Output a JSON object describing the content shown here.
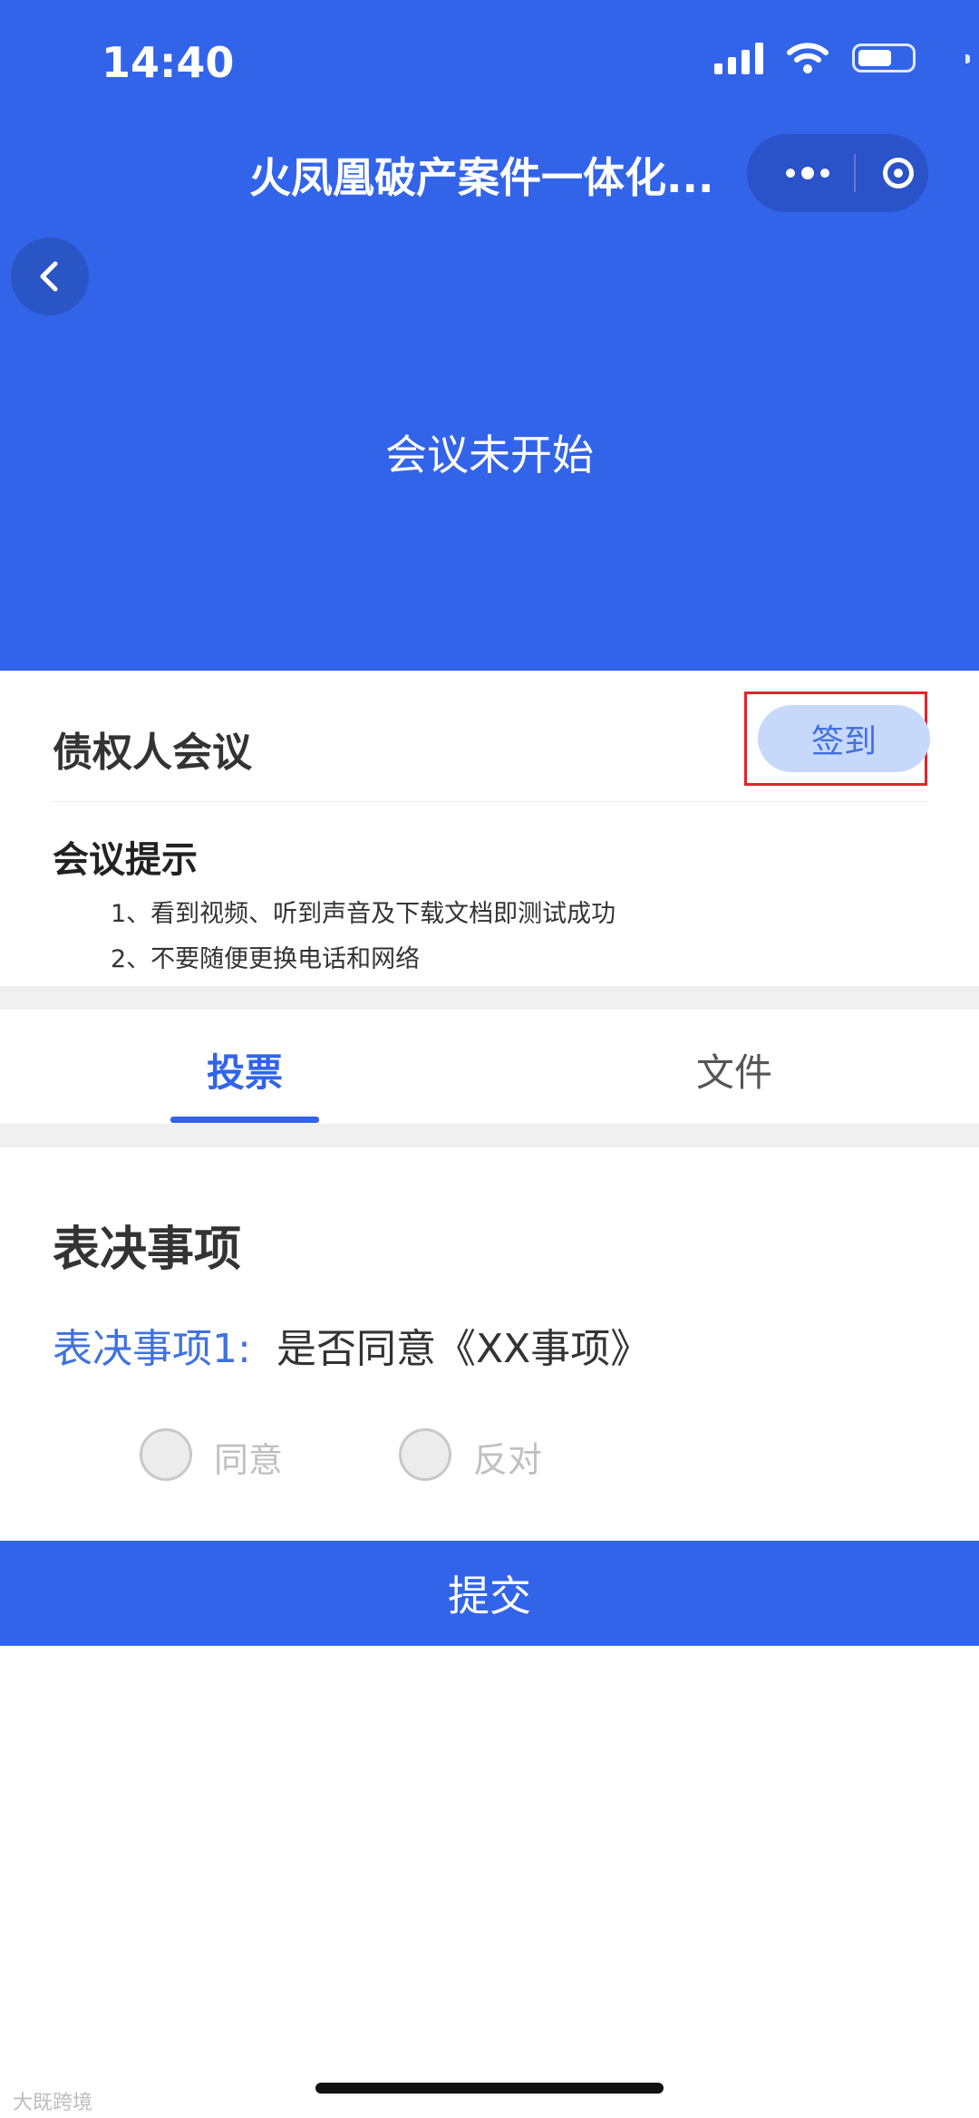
{
  "status_bar": {
    "time": "14:40"
  },
  "nav": {
    "title": "火凤凰破产案件一体化..."
  },
  "hero": {
    "meeting_status": "会议未开始",
    "background_color": "#3264e9"
  },
  "meeting": {
    "title": "债权人会议",
    "sign_in_label": "签到",
    "tips_title": "会议提示",
    "tips": [
      "1、看到视频、听到声音及下载文档即测试成功",
      "2、不要随便更换电话和网络"
    ]
  },
  "tabs": [
    {
      "label": "投票",
      "active": true
    },
    {
      "label": "文件",
      "active": false
    }
  ],
  "voting": {
    "heading": "表决事项",
    "items": [
      {
        "label": "表决事项1:",
        "text": "是否同意《XX事项》",
        "options": [
          "同意",
          "反对"
        ]
      }
    ],
    "submit_label": "提交"
  },
  "watermark": "大既跨境",
  "icons": {
    "back": "chevron-left-icon",
    "more": "more-dots-icon",
    "close": "target-close-icon",
    "signal": "signal-icon",
    "wifi": "wifi-icon",
    "battery": "battery-icon"
  }
}
